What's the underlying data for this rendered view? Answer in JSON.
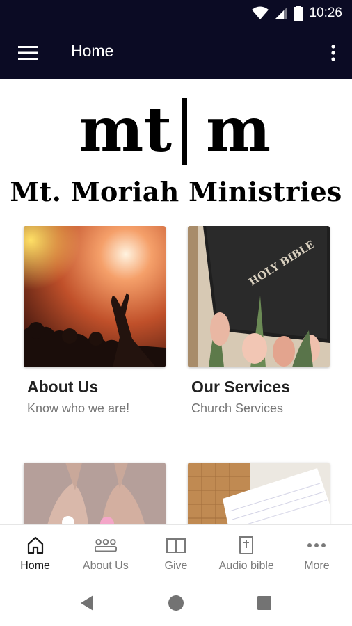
{
  "status_bar": {
    "time": "10:26",
    "icons": [
      "wifi-icon",
      "signal-icon",
      "battery-icon"
    ]
  },
  "app_bar": {
    "title": "Home",
    "icons": [
      "menu-icon",
      "more-vert-icon"
    ]
  },
  "logo": {
    "mark_left": "mt",
    "mark_right": "m",
    "name": "Mt. Moriah Ministries"
  },
  "cards": [
    {
      "title": "About Us",
      "subtitle": "Know who we are!",
      "image": "worship-crowd-image"
    },
    {
      "title": "Our Services",
      "subtitle": "Church Services",
      "image": "holy-bible-tulips-image"
    },
    {
      "title": "",
      "subtitle": "",
      "image": "open-hands-flowers-image"
    },
    {
      "title": "",
      "subtitle": "",
      "image": "notebook-desk-image"
    }
  ],
  "bottom_nav": {
    "items": [
      {
        "label": "Home",
        "icon": "home-icon",
        "active": true
      },
      {
        "label": "About Us",
        "icon": "group-icon",
        "active": false
      },
      {
        "label": "Give",
        "icon": "book-open-icon",
        "active": false
      },
      {
        "label": "Audio bible",
        "icon": "bible-cross-icon",
        "active": false
      },
      {
        "label": "More",
        "icon": "more-horiz-icon",
        "active": false
      }
    ]
  },
  "system_nav": [
    "back-icon",
    "home-circle-icon",
    "recents-icon"
  ],
  "colors": {
    "app_bar": "#0b0b24",
    "active_nav": "#1a1a1a",
    "inactive_nav": "#7a7a7a",
    "subtitle": "#757575"
  }
}
